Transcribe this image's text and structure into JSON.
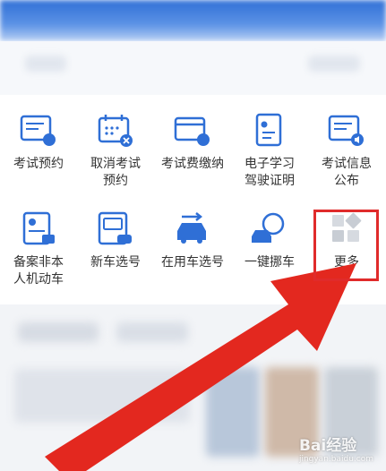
{
  "services": [
    {
      "label": "考试预约",
      "icon": "exam-booking-icon"
    },
    {
      "label": "取消考试\n预约",
      "icon": "cancel-booking-icon"
    },
    {
      "label": "考试费缴纳",
      "icon": "exam-fee-icon"
    },
    {
      "label": "电子学习\n驾驶证明",
      "icon": "e-learning-certificate-icon"
    },
    {
      "label": "考试信息\n公布",
      "icon": "exam-info-icon"
    },
    {
      "label": "备案非本\n人机动车",
      "icon": "vehicle-filing-icon"
    },
    {
      "label": "新车选号",
      "icon": "new-car-plate-icon"
    },
    {
      "label": "在用车选号",
      "icon": "used-car-plate-icon"
    },
    {
      "label": "一键挪车",
      "icon": "move-car-icon"
    },
    {
      "label": "更多",
      "icon": "more-grid-icon"
    }
  ],
  "colors": {
    "accent": "#2f6fd6",
    "highlight": "#e02b2b"
  },
  "watermark": {
    "brand": "Bai经验",
    "url": "jingyan.baidu.com"
  }
}
